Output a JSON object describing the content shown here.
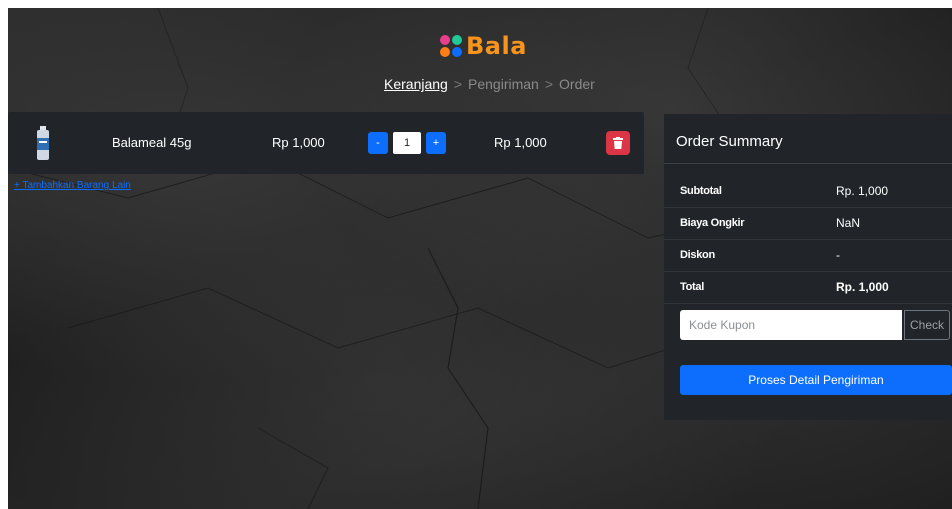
{
  "brand": {
    "name": "Bala",
    "logo_colors": [
      "#e83e8c",
      "#20c997",
      "#fd7e14",
      "#0d6efd"
    ]
  },
  "breadcrumb": {
    "items": [
      "Keranjang",
      "Pengiriman",
      "Order"
    ],
    "separator": ">",
    "active_index": 0
  },
  "cart": {
    "items": [
      {
        "thumb_icon": "bottle-icon",
        "name": "Balameal 45g",
        "price": "Rp 1,000",
        "qty": "1",
        "minus_label": "-",
        "plus_label": "+",
        "total": "Rp 1,000",
        "delete_icon": "trash-icon"
      }
    ],
    "add_more_link": "+ Tambahkan Barang Lain"
  },
  "summary": {
    "title": "Order Summary",
    "rows": [
      {
        "label": "Subtotal",
        "value": "Rp. 1,000"
      },
      {
        "label": "Biaya Ongkir",
        "value": "NaN"
      },
      {
        "label": "Diskon",
        "value": "-"
      },
      {
        "label": "Total",
        "value": "Rp. 1,000"
      }
    ],
    "coupon_placeholder": "Kode Kupon",
    "check_label": "Check",
    "proceed_label": "Proses Detail Pengiriman"
  },
  "colors": {
    "primary": "#0d6efd",
    "danger": "#dc3545",
    "panel": "#212529",
    "brand_orange": "#f7941d"
  }
}
